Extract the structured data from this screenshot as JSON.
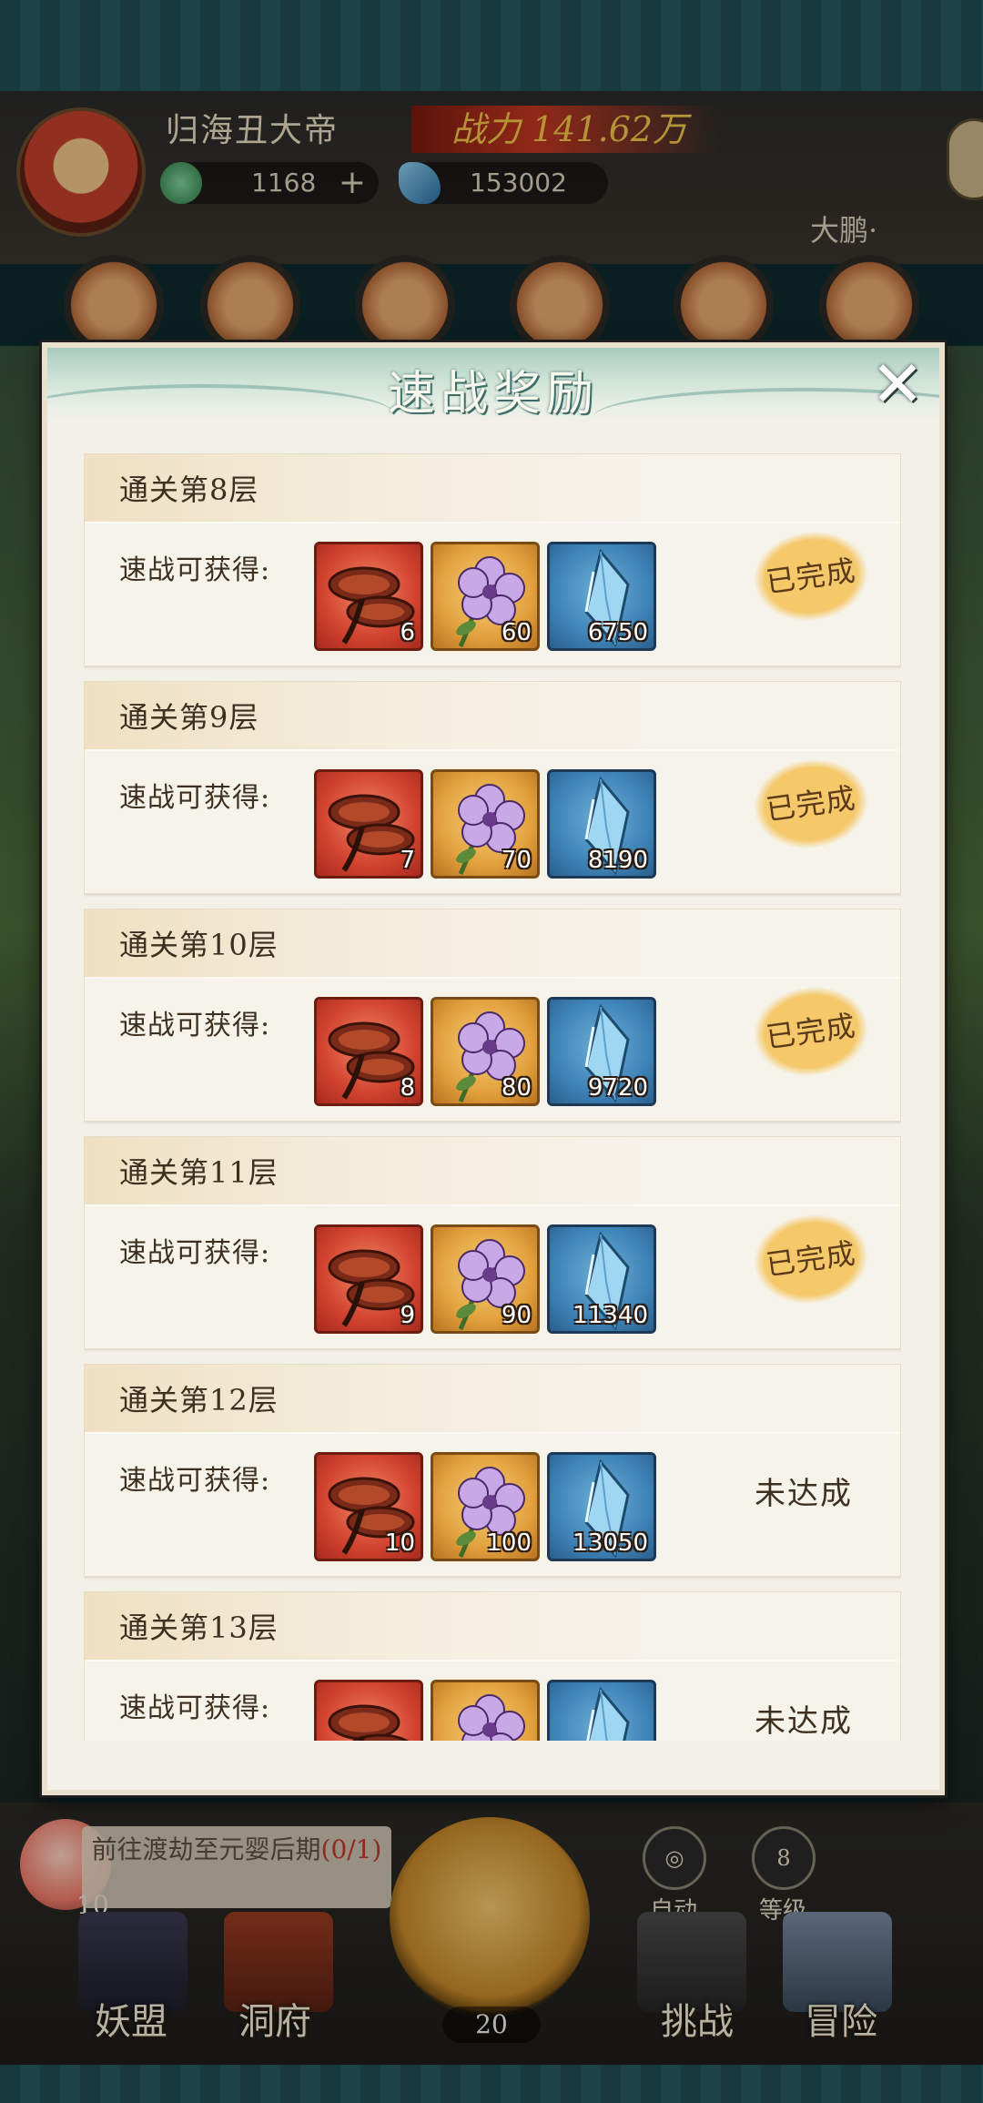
{
  "player": {
    "name": "归海丑大帝",
    "power": "战力 141.62万",
    "currency_1": "1168",
    "currency_2": "153002",
    "server": "大鹏·",
    "icons": {
      "currency_1": "jade-coin-icon",
      "currency_2": "blue-crystal-icon"
    }
  },
  "modal": {
    "title": "速战奖励",
    "close_icon": "close-x-icon",
    "reward_label": "速战可获得:",
    "rows": [
      {
        "title": "通关第8层",
        "items": [
          "6",
          "60",
          "6750"
        ],
        "status": "已完成",
        "done": true
      },
      {
        "title": "通关第9层",
        "items": [
          "7",
          "70",
          "8190"
        ],
        "status": "已完成",
        "done": true
      },
      {
        "title": "通关第10层",
        "items": [
          "8",
          "80",
          "9720"
        ],
        "status": "已完成",
        "done": true
      },
      {
        "title": "通关第11层",
        "items": [
          "9",
          "90",
          "11340"
        ],
        "status": "已完成",
        "done": true
      },
      {
        "title": "通关第12层",
        "items": [
          "10",
          "100",
          "13050"
        ],
        "status": "未达成",
        "done": false
      },
      {
        "title": "通关第13层",
        "items": [
          "",
          "",
          ""
        ],
        "status": "未达成",
        "done": false
      }
    ],
    "item_icons": [
      "lingzhi-mushroom-icon",
      "purple-flower-icon",
      "blue-crystal-icon"
    ]
  },
  "bottom": {
    "quest_text": "前往渡劫至元婴后期",
    "quest_progress": "(0/1)",
    "peach_count": "10",
    "axe_count": "20",
    "auto_label": "自动",
    "level_value": "8",
    "level_label": "等级",
    "nav": [
      "妖盟",
      "洞府",
      "挑战",
      "冒险"
    ]
  },
  "colors": {
    "modal_bg": "#f3f0e7",
    "done_badge": "#f5c86a",
    "text": "#3d3020",
    "header_teal": "#a9cdbf"
  }
}
